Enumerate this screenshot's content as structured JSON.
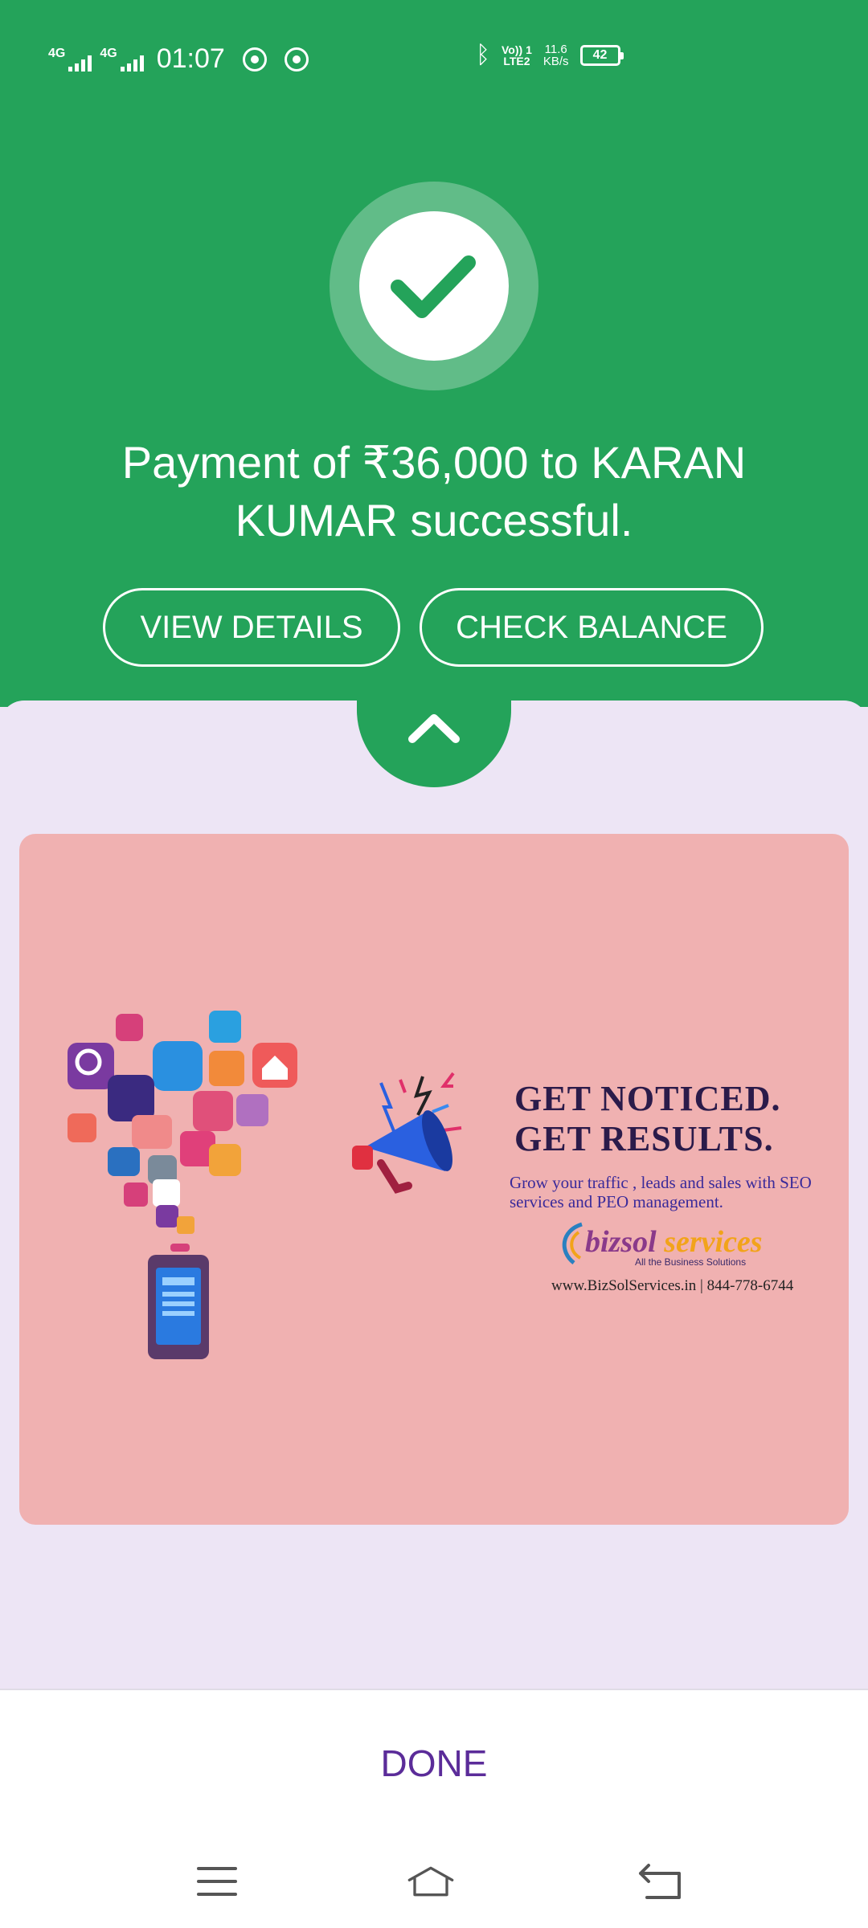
{
  "status_bar": {
    "network_1": "4G",
    "network_2": "4G",
    "time": "01:07",
    "volte_line1": "Vo)) 1",
    "volte_line2": "LTE2",
    "speed_value": "11.6",
    "speed_unit": "KB/s",
    "battery": "42",
    "icons": [
      "whatsapp-icon",
      "chrome-icon",
      "bluetooth-icon"
    ]
  },
  "payment": {
    "message": "Payment of ₹36,000 to KARAN KUMAR successful.",
    "view_details": "VIEW DETAILS",
    "check_balance": "CHECK BALANCE"
  },
  "ad": {
    "headline_1": "GET NOTICED.",
    "headline_2": "GET RESULTS.",
    "subtext": "Grow your traffic , leads and sales with SEO services and PEO management.",
    "brand_1": "bizsol",
    "brand_2": "services",
    "brand_tagline": "All the Business Solutions",
    "contact": "www.BizSolServices.in |  844-778-6744"
  },
  "footer": {
    "done_label": "DONE"
  },
  "colors": {
    "primary_green": "#24a35a",
    "sheet_bg": "#ede5f5",
    "ad_bg": "#f0b1b1",
    "done_purple": "#5b2c99"
  }
}
